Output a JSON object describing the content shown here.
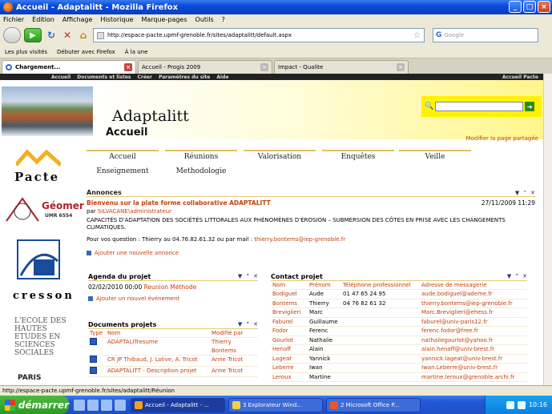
{
  "window": {
    "title": "Accueil - Adaptalitt - Mozilla Firefox",
    "min": "_",
    "max": "□",
    "close": "×"
  },
  "menu": [
    "Fichier",
    "Édition",
    "Affichage",
    "Historique",
    "Marque-pages",
    "Outils",
    "?"
  ],
  "toolbar": {
    "url": "http://espace-pacte.upmf-grenoble.fr/sites/adaptalitt/default.aspx",
    "search_placeholder": "Google",
    "search_engine": "G"
  },
  "bookmarks": [
    "Les plus visités",
    "Débuter avec Firefox",
    "À la une"
  ],
  "tabs": [
    {
      "label": "Chargement...",
      "active": true
    },
    {
      "label": "Accueil - Progis 2009",
      "active": false
    },
    {
      "label": "Impact - Qualite",
      "active": false
    }
  ],
  "site": {
    "top_links": [
      "Accueil",
      "Documents et listes",
      "Créer",
      "Paramètres du site",
      "Aide"
    ],
    "top_right": "Accueil Pacte",
    "title": "Adaptalitt",
    "subtitle": "Accueil",
    "modify_link": "Modifier la page partagée",
    "logos": {
      "pacte": "Pacte",
      "geomer": "Géomer",
      "geomer_sub": "UMR 6554",
      "cresson": "cresson",
      "ecole": "L'ECOLE DES HAUTES ETUDES EN SCIENCES SOCIALES",
      "paris": "PARIS"
    }
  },
  "nav": {
    "row1": [
      "Accueil",
      "Réunions",
      "Valorisation",
      "Enquêtes",
      "Veille"
    ],
    "row2": [
      "Enseignement",
      "Methodologie"
    ]
  },
  "annonces": {
    "title": "Annonces",
    "item_title": "Bienvenu sur la plate forme collaborative ADAPTALITT",
    "item_date": "27/11/2009 11:29",
    "item_by_prefix": "par",
    "item_by": "SILVACANE\\administrateur",
    "item_body": "CAPACITÉS D'ADAPTATION DES SOCIÉTÉS LITTORALES AUX PHÉNOMÈNES D'ÉROSION – SUBMERSION DES CÔTES EN PRISE AVEC LES CHANGEMENTS CLIMATIQUES.",
    "item_contact": "Pour vos question : Thierry au 04.76.82.61.32 ou par mail : ",
    "item_contact_mail": "thierry.bontems@iep-grenoble.fr",
    "add_link": "Ajouter une nouvelle annonce"
  },
  "agenda": {
    "title": "Agenda du projet",
    "date": "02/02/2010 00:00",
    "event": "Reunion Méthode",
    "add_link": "Ajouter un nouvel événement"
  },
  "documents": {
    "title": "Documents projets",
    "headers": [
      "Type",
      "Nom",
      "Modifié par"
    ],
    "rows": [
      [
        "",
        "ADAPTALITresume",
        "Thierry Bontems"
      ],
      [
        "",
        "CR JP Thibaud, J. Lolive, A. Tricot",
        "Anne Tricot"
      ],
      [
        "",
        "ADAPTALITT - Description projet",
        "Anne Tricot"
      ]
    ]
  },
  "contact": {
    "title": "Contact projet",
    "headers": [
      "Nom",
      "Prénom",
      "Téléphone professionnel",
      "Adresse de messagerie"
    ],
    "rows": [
      [
        "Bodiguel",
        "Aude",
        "01 47 65 24 95",
        "aude.bodiguel@ademe.fr"
      ],
      [
        "Bontems",
        "Thierry",
        "04 76 82 61 32",
        "thierry.bontems@iep-grenoble.fr"
      ],
      [
        "Breviglieri",
        "Marc",
        "",
        "Marc.Breviglieri@ehess.fr"
      ],
      [
        "Faburel",
        "Guillaume",
        "",
        "faburel@univ-paris12.fr"
      ],
      [
        "Fodor",
        "Ferenc",
        "",
        "ferenc.fodor@free.fr"
      ],
      [
        "Gourlot",
        "Nathalie",
        "",
        "nathaliegourlot@yahoo.fr"
      ],
      [
        "Henaff",
        "Alain",
        "",
        "alain.henaff@univ-brest.fr"
      ],
      [
        "Lageat",
        "Yannick",
        "",
        "yannick.lageat@univ-brest.fr"
      ],
      [
        "Leberre",
        "Iwan",
        "",
        "Iwan.Leberre@univ-brest.fr"
      ],
      [
        "Leroux",
        "Martine",
        "",
        "martine.leroux@grenoble.archi.fr"
      ]
    ]
  },
  "status": "http://espace-pacte.upmf-grenoble.fr/sites/adaptalitt/Réunion",
  "taskbar": {
    "start": "démarrer",
    "tasks": [
      "Accueil - Adaptalitt - ...",
      "3 Explorateur Wind...",
      "2 Microsoft Office P..."
    ],
    "clock": "10:16"
  }
}
